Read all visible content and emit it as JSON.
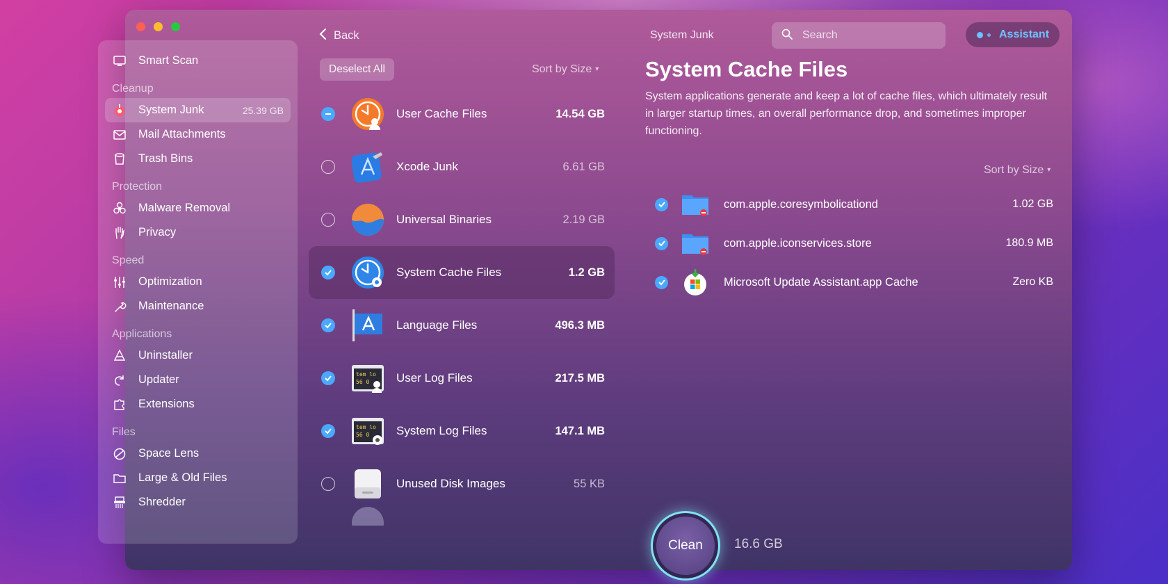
{
  "window": {
    "topbar_title": "System Junk"
  },
  "nav": {
    "back_label": "Back"
  },
  "search": {
    "placeholder": "Search"
  },
  "assistant": {
    "label": "Assistant"
  },
  "sidebar": {
    "top_item": {
      "label": "Smart Scan",
      "icon": "monitor-icon"
    },
    "sections": [
      {
        "title": "Cleanup",
        "items": [
          {
            "label": "System Junk",
            "size": "25.39 GB",
            "icon": "system-junk-icon",
            "active": true
          },
          {
            "label": "Mail Attachments",
            "icon": "mail-icon"
          },
          {
            "label": "Trash Bins",
            "icon": "trash-icon"
          }
        ]
      },
      {
        "title": "Protection",
        "items": [
          {
            "label": "Malware Removal",
            "icon": "biohazard-icon"
          },
          {
            "label": "Privacy",
            "icon": "hand-icon"
          }
        ]
      },
      {
        "title": "Speed",
        "items": [
          {
            "label": "Optimization",
            "icon": "sliders-icon"
          },
          {
            "label": "Maintenance",
            "icon": "wrench-icon"
          }
        ]
      },
      {
        "title": "Applications",
        "items": [
          {
            "label": "Uninstaller",
            "icon": "uninstaller-icon"
          },
          {
            "label": "Updater",
            "icon": "updater-icon"
          },
          {
            "label": "Extensions",
            "icon": "puzzle-icon"
          }
        ]
      },
      {
        "title": "Files",
        "items": [
          {
            "label": "Space Lens",
            "icon": "space-lens-icon"
          },
          {
            "label": "Large & Old Files",
            "icon": "folder-icon"
          },
          {
            "label": "Shredder",
            "icon": "shredder-icon"
          }
        ]
      }
    ]
  },
  "middle": {
    "deselect_label": "Deselect All",
    "sort_label": "Sort by Size",
    "items": [
      {
        "label": "User Cache Files",
        "size": "14.54 GB",
        "state": "partial",
        "icon": "user-cache-icon"
      },
      {
        "label": "Xcode Junk",
        "size": "6.61 GB",
        "state": "off",
        "icon": "xcode-icon"
      },
      {
        "label": "Universal Binaries",
        "size": "2.19 GB",
        "state": "off",
        "icon": "universal-binaries-icon"
      },
      {
        "label": "System Cache Files",
        "size": "1.2 GB",
        "state": "on",
        "icon": "system-cache-icon",
        "selected": true
      },
      {
        "label": "Language Files",
        "size": "496.3 MB",
        "state": "on",
        "icon": "language-flag-icon"
      },
      {
        "label": "User Log Files",
        "size": "217.5 MB",
        "state": "on",
        "icon": "user-log-icon"
      },
      {
        "label": "System Log Files",
        "size": "147.1 MB",
        "state": "on",
        "icon": "system-log-icon"
      },
      {
        "label": "Unused Disk Images",
        "size": "55 KB",
        "state": "off",
        "icon": "disk-image-icon"
      }
    ]
  },
  "detail": {
    "title": "System Cache Files",
    "description": "System applications generate and keep a lot of cache files, which ultimately result in larger startup times, an overall performance drop, and sometimes improper functioning.",
    "sort_label": "Sort by Size",
    "files": [
      {
        "name": "com.apple.coresymbolicationd",
        "size": "1.02 GB",
        "icon": "folder-icon"
      },
      {
        "name": "com.apple.iconservices.store",
        "size": "180.9 MB",
        "icon": "folder-icon"
      },
      {
        "name": "Microsoft Update Assistant.app Cache",
        "size": "Zero KB",
        "icon": "microsoft-update-icon"
      }
    ]
  },
  "footer": {
    "clean_label": "Clean",
    "total": "16.6 GB"
  },
  "colors": {
    "accent": "#4aa8ff",
    "assistant": "#6cc3ff",
    "ring": "#7fe3f0"
  }
}
